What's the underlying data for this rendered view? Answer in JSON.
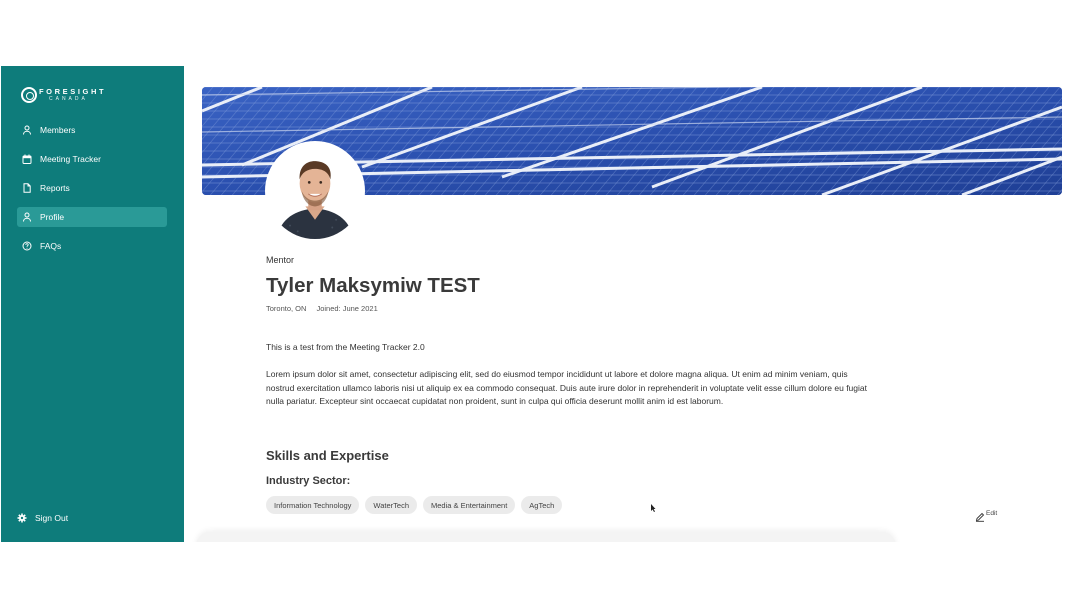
{
  "sidebar": {
    "logo": {
      "main": "FORESIGHT",
      "sub": "CANADA"
    },
    "items": [
      {
        "label": "Members",
        "icon": "user-icon"
      },
      {
        "label": "Meeting Tracker",
        "icon": "calendar-icon"
      },
      {
        "label": "Reports",
        "icon": "document-icon"
      },
      {
        "label": "Profile",
        "icon": "user-icon",
        "active": true
      },
      {
        "label": "FAQs",
        "icon": "help-circle-icon"
      }
    ],
    "signout": {
      "label": "Sign Out",
      "icon": "gear-icon"
    }
  },
  "profile": {
    "role": "Mentor",
    "name": "Tyler Maksymiw TEST",
    "location": "Toronto, ON",
    "joined": "Joined: June 2021",
    "bio_short": "This is a test from the Meeting Tracker 2.0",
    "bio_long": "Lorem ipsum dolor sit amet, consectetur adipiscing elit, sed do eiusmod tempor incididunt ut labore et dolore magna aliqua. Ut enim ad minim veniam, quis nostrud exercitation ullamco laboris nisi ut aliquip ex ea commodo consequat. Duis aute irure dolor in reprehenderit in voluptate velit esse cillum dolore eu fugiat nulla pariatur. Excepteur sint occaecat cupidatat non proident, sunt in culpa qui officia deserunt mollit anim id est laborum."
  },
  "skills": {
    "title": "Skills and Expertise",
    "sector_label": "Industry Sector:",
    "tags": [
      "Information Technology",
      "WaterTech",
      "Media & Entertainment",
      "AgTech"
    ]
  },
  "edit": {
    "label": "Edit"
  },
  "colors": {
    "sidebar": "#0e7c7b",
    "sidebar_active": "#2a9a97",
    "tag_bg": "#ebebeb"
  }
}
